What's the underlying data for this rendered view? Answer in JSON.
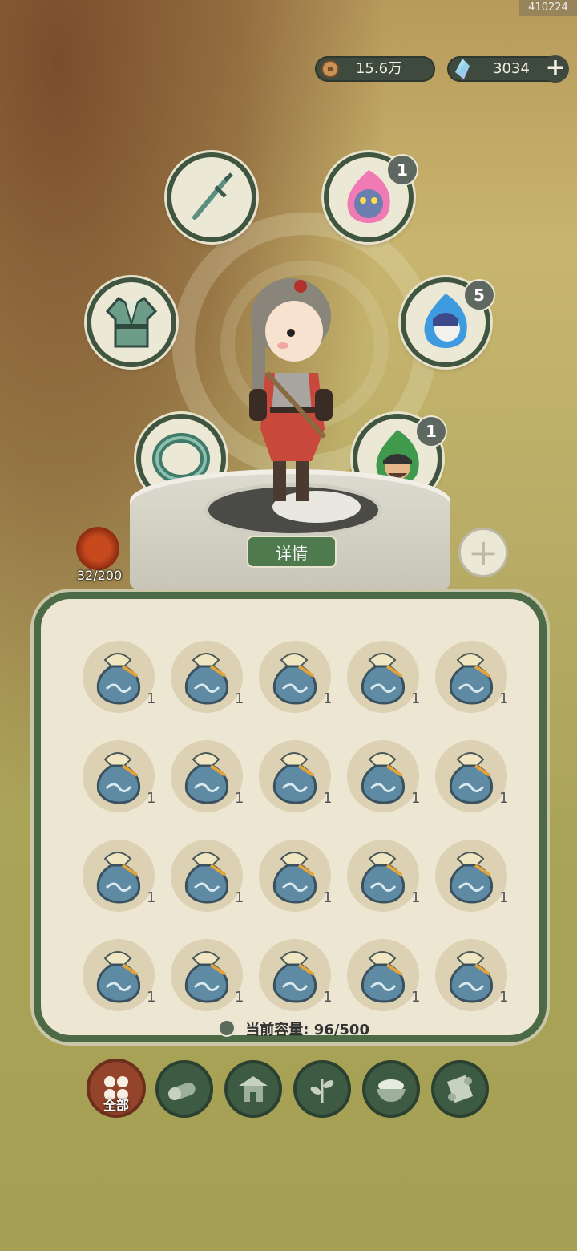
{
  "build_id": "410224",
  "currency": {
    "coins": "15.6万",
    "gems": "3034"
  },
  "equipment": {
    "weapon_icon": "sword-icon",
    "armor_icon": "robe-icon",
    "accessory_icon": "jade-bracelet-icon",
    "spirit_slots": [
      {
        "icon": "beast-spirit-icon",
        "count": "1"
      },
      {
        "icon": "blue-spirit-icon",
        "count": "5"
      },
      {
        "icon": "green-spirit-icon",
        "count": "1"
      }
    ]
  },
  "detail_button": "详情",
  "level": "32/200",
  "inventory": {
    "item_icon": "blue-pouch-icon",
    "items": [
      "1",
      "1",
      "1",
      "1",
      "1",
      "1",
      "1",
      "1",
      "1",
      "1",
      "1",
      "1",
      "1",
      "1",
      "1",
      "1",
      "1",
      "1",
      "1",
      "1"
    ],
    "capacity_label": "当前容量:",
    "capacity_value": "96/500"
  },
  "tabs": [
    {
      "label": "全部",
      "icon": "all-icon",
      "active": true
    },
    {
      "label": "",
      "icon": "log-icon"
    },
    {
      "label": "",
      "icon": "house-icon"
    },
    {
      "label": "",
      "icon": "herb-icon"
    },
    {
      "label": "",
      "icon": "rice-bowl-icon"
    },
    {
      "label": "",
      "icon": "scroll-icon"
    }
  ],
  "colors": {
    "panel_border": "#4d6a46",
    "active_tab": "#93442a",
    "tab": "#3d5a43"
  }
}
